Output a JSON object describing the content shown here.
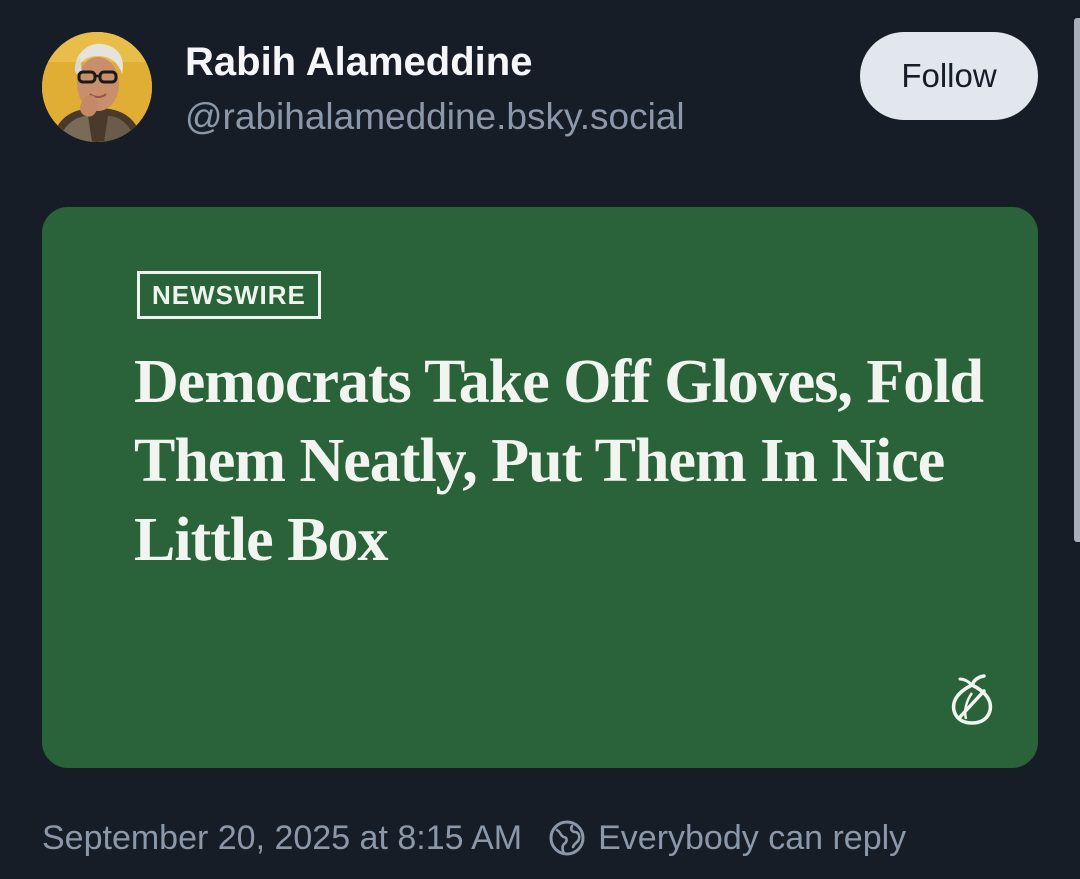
{
  "post": {
    "author": {
      "display_name": "Rabih Alameddine",
      "handle": "@rabihalameddine.bsky.social",
      "avatar_icon": "profile-photo"
    },
    "follow_label": "Follow",
    "embed": {
      "kicker": "NEWSWIRE",
      "headline": "Democrats Take Off Gloves, Fold Them Neatly, Put Them In Nice Little Box",
      "logo_icon": "onion-logo-icon",
      "background_color": "#2a6339"
    },
    "meta": {
      "timestamp": "September 20, 2025 at 8:15 AM",
      "reply_icon": "globe-icon",
      "reply_setting": "Everybody can reply"
    }
  },
  "colors": {
    "background": "#171d26",
    "name_text": "#f4f6f9",
    "muted_text": "#8b98aa",
    "follow_button_bg": "#e2e6ed"
  }
}
